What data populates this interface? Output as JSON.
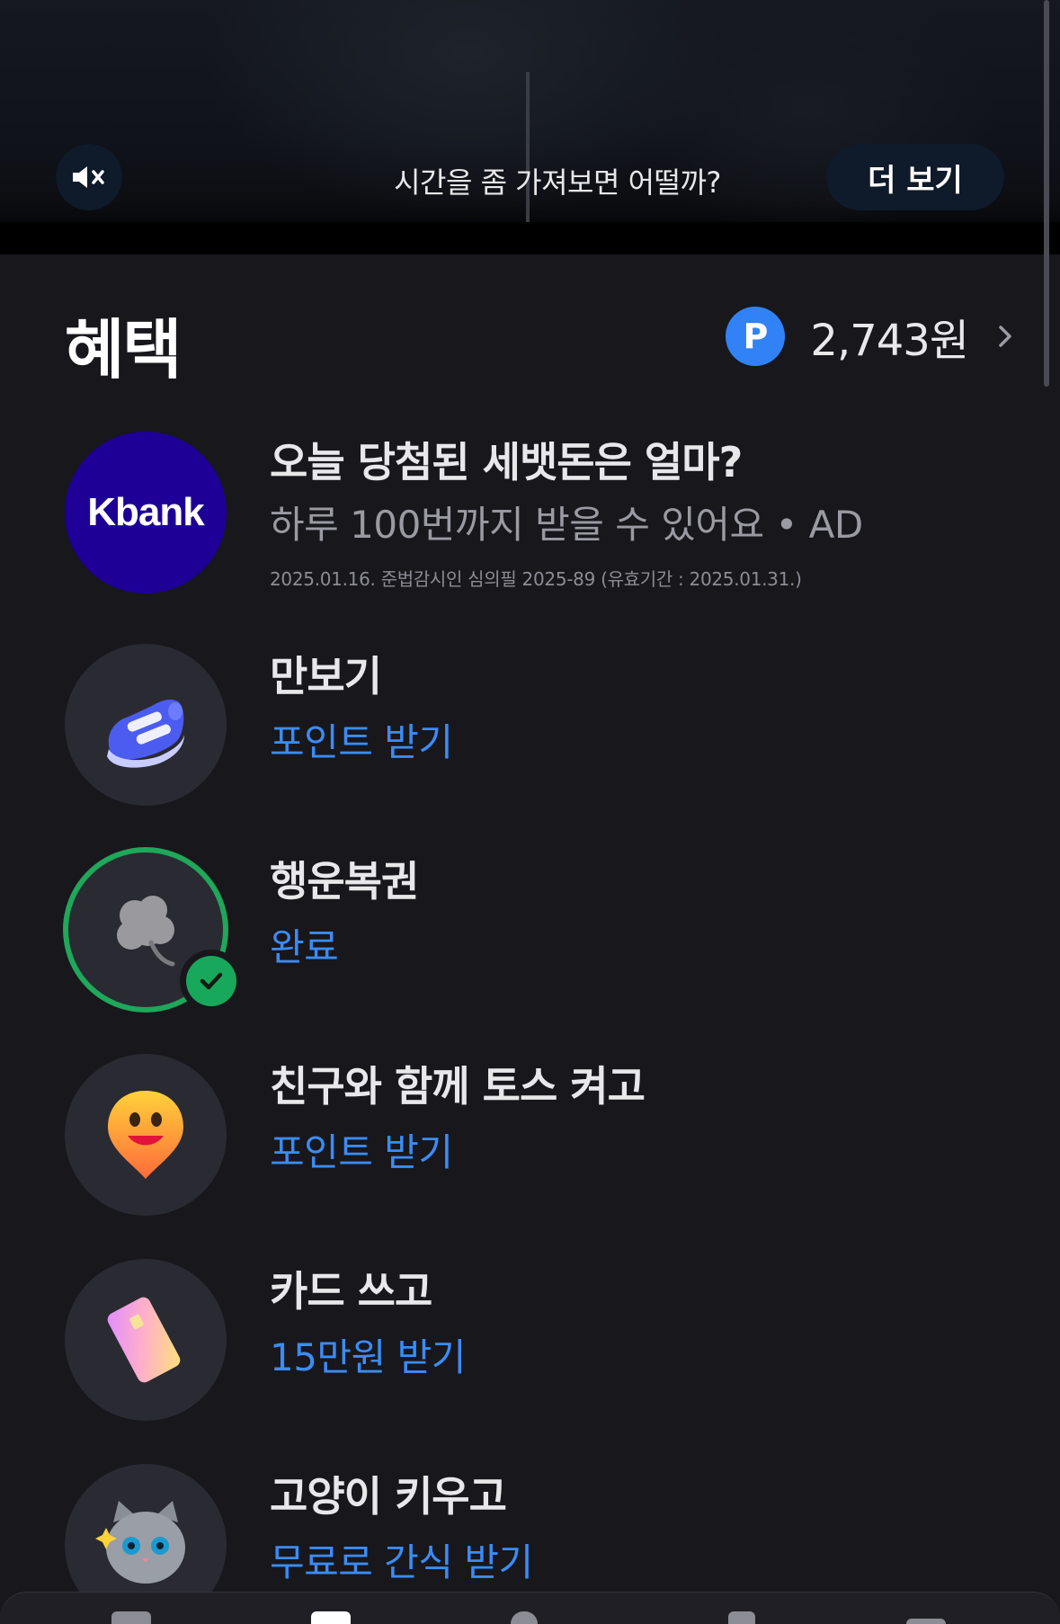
{
  "video": {
    "caption": "시간을 좀 가져보면 어떨까?",
    "more_label": "더 보기",
    "mute_icon": "speaker-muted-icon"
  },
  "header": {
    "title": "혜택",
    "points_badge": "P",
    "points_value": "2,743원"
  },
  "items": [
    {
      "title": "오늘 당첨된 세뱃돈은 얼마?",
      "subtitle": "하루 100번까지 받을 수 있어요 • AD",
      "fine_print": "2025.01.16. 준법감시인 심의필 2025-89 (유효기간 : 2025.01.31.)",
      "logo_text": "Kbank"
    },
    {
      "title": "만보기",
      "action": "포인트 받기",
      "icon": "sneaker-icon"
    },
    {
      "title": "행운복권",
      "action": "완료",
      "icon": "clover-icon"
    },
    {
      "title": "친구와 함께 토스 켜고",
      "action": "포인트 받기",
      "icon": "smiley-pin-icon"
    },
    {
      "title": "카드 쓰고",
      "action": "15만원 받기",
      "icon": "card-icon"
    },
    {
      "title": "고양이 키우고",
      "action": "무료로 간식 받기",
      "icon": "cat-icon"
    }
  ],
  "colors": {
    "background": "#17171c",
    "accent": "#3182f6",
    "link": "#3b8cf6",
    "success": "#17a85b",
    "kbank": "#1e0096"
  }
}
